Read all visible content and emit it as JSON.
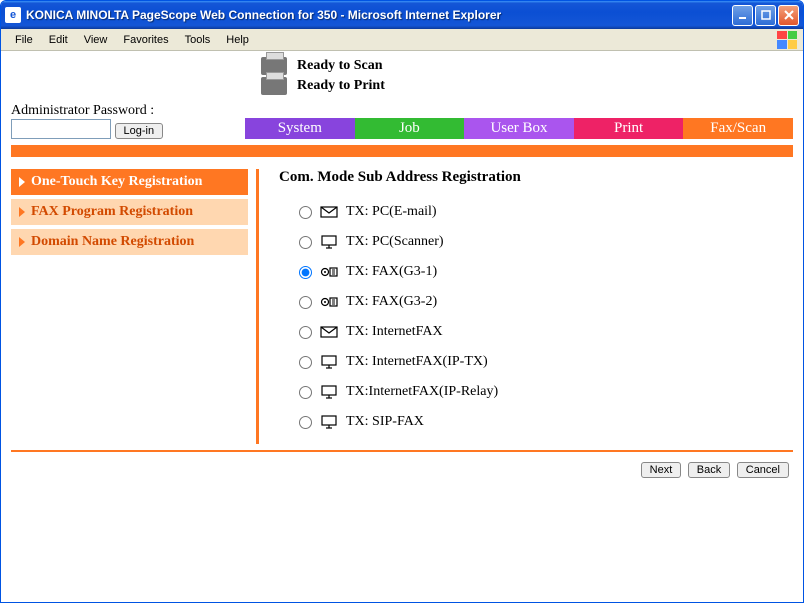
{
  "window": {
    "title": "KONICA MINOLTA PageScope Web Connection for 350 - Microsoft Internet Explorer"
  },
  "menubar": {
    "items": [
      "File",
      "Edit",
      "View",
      "Favorites",
      "Tools",
      "Help"
    ]
  },
  "status": {
    "scan": "Ready to Scan",
    "print": "Ready to Print"
  },
  "login": {
    "label": "Administrator Password :",
    "button": "Log-in"
  },
  "topnav": {
    "system": "System",
    "job": "Job",
    "userbox": "User Box",
    "print": "Print",
    "faxscan": "Fax/Scan"
  },
  "sidebar": {
    "items": [
      {
        "label": "One-Touch Key Registration",
        "active": true
      },
      {
        "label": "FAX Program Registration",
        "active": false
      },
      {
        "label": "Domain Name Registration",
        "active": false
      }
    ]
  },
  "panel": {
    "title": "Com. Mode Sub Address Registration",
    "options": [
      {
        "icon": "mail",
        "label": "TX: PC(E-mail)",
        "selected": false
      },
      {
        "icon": "pc",
        "label": "TX: PC(Scanner)",
        "selected": false
      },
      {
        "icon": "fax",
        "label": "TX: FAX(G3-1)",
        "selected": true
      },
      {
        "icon": "fax",
        "label": "TX: FAX(G3-2)",
        "selected": false
      },
      {
        "icon": "mail",
        "label": "TX: InternetFAX",
        "selected": false
      },
      {
        "icon": "pc",
        "label": "TX: InternetFAX(IP-TX)",
        "selected": false
      },
      {
        "icon": "pc",
        "label": "TX:InternetFAX(IP-Relay)",
        "selected": false
      },
      {
        "icon": "pc",
        "label": "TX: SIP-FAX",
        "selected": false
      }
    ]
  },
  "footer": {
    "next": "Next",
    "back": "Back",
    "cancel": "Cancel"
  }
}
